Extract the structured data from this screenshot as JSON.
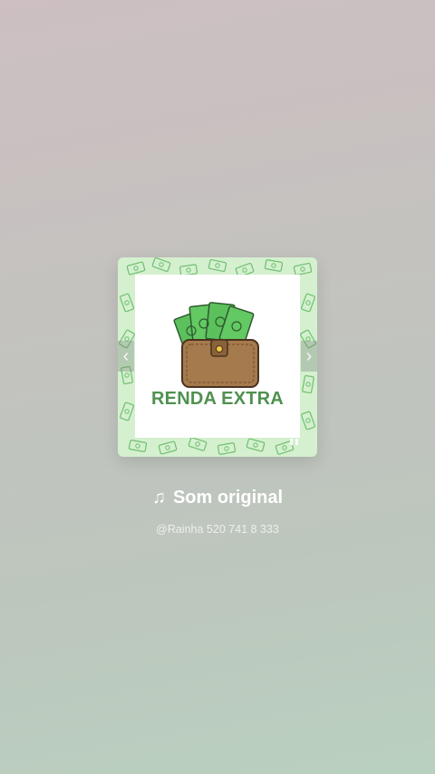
{
  "audio": {
    "title": "Som original",
    "author": "@Rainha 520 741 8 333",
    "note_icon": "♫"
  },
  "cover": {
    "label": "RENDA EXTRA",
    "icon": "wallet-with-money-icon",
    "colors": {
      "pattern_bg": "#d4f0cf",
      "bill_green": "#5cc15c",
      "label_green": "#4f9150",
      "wallet_brown": "#a57a4d"
    }
  },
  "nav": {
    "prev_icon": "chevron-left-icon",
    "next_icon": "chevron-right-icon",
    "prev_glyph": "‹",
    "next_glyph": "›"
  }
}
